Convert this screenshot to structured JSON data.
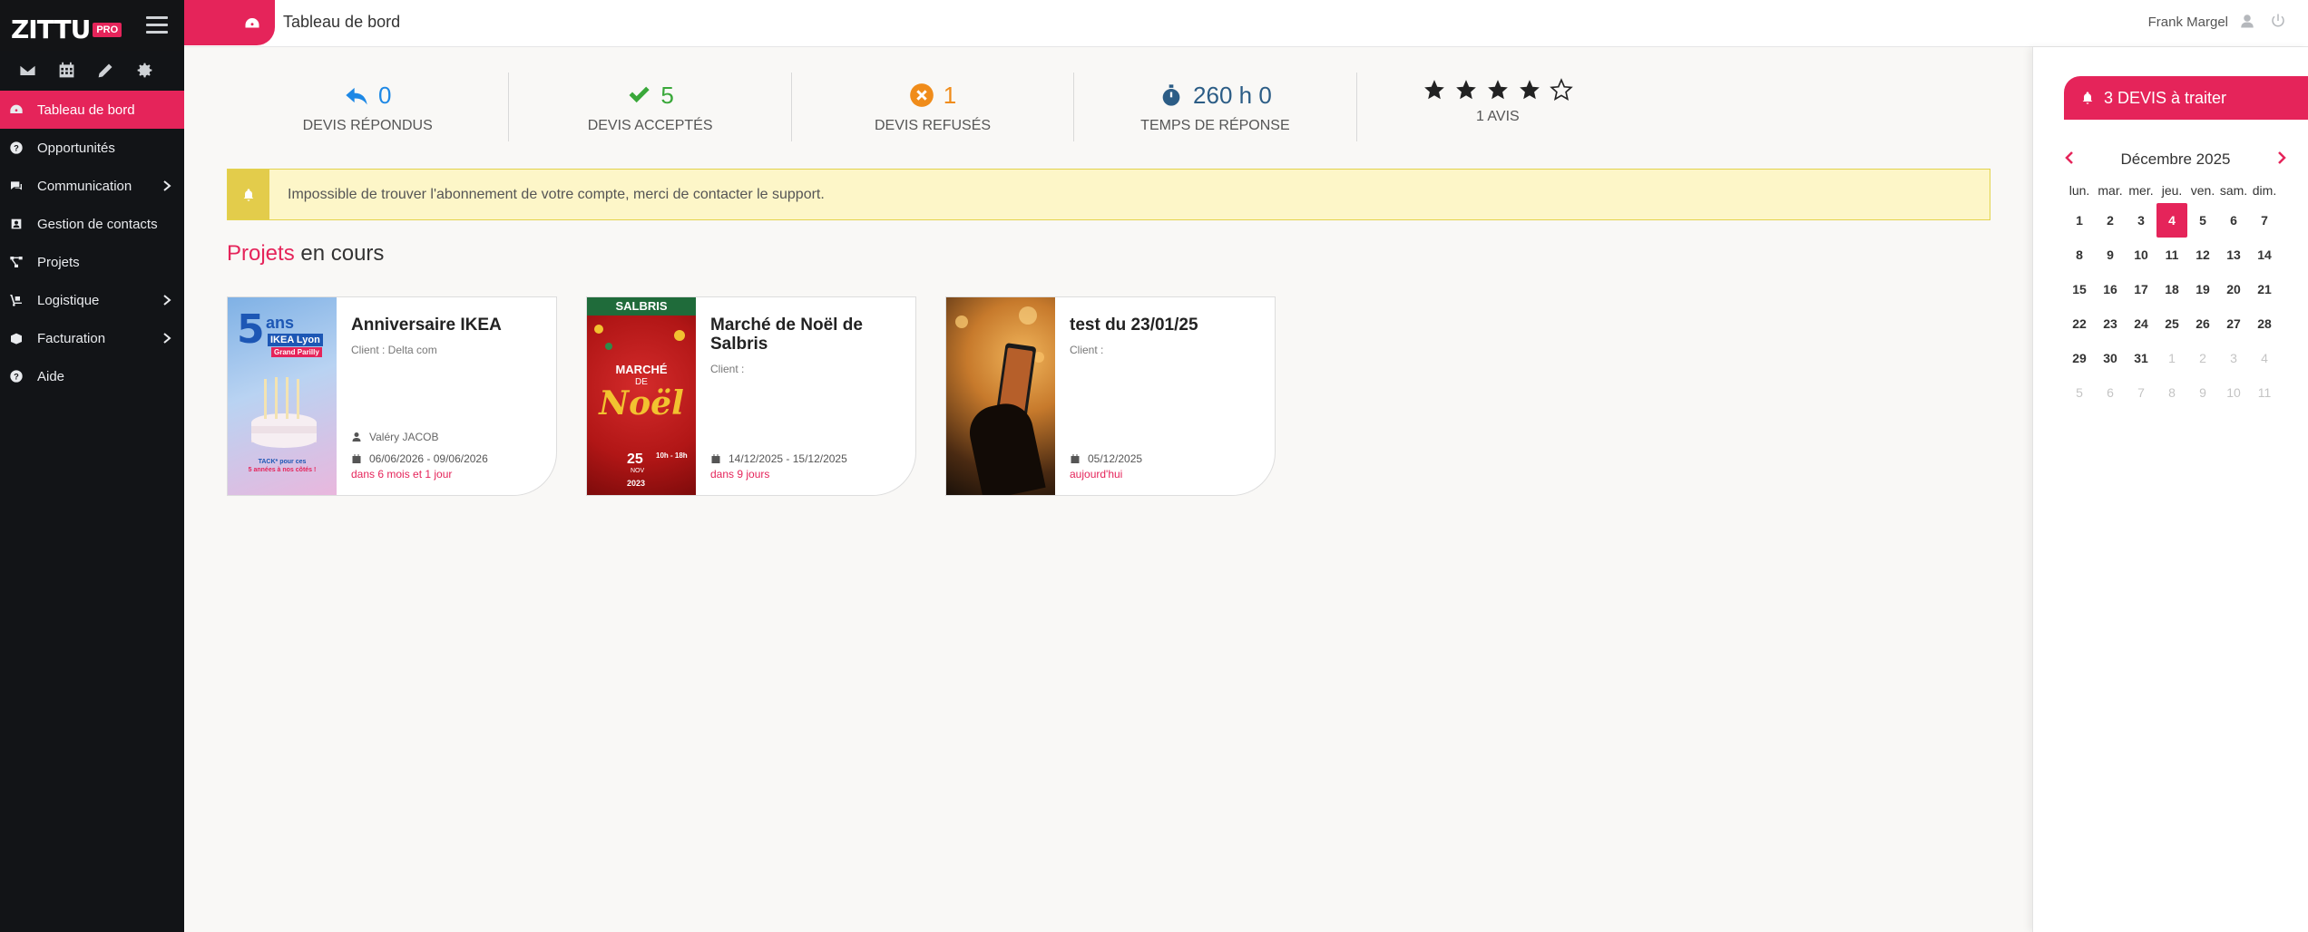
{
  "sidebar": {
    "brand": "ZITTU",
    "brand_badge": "PRO",
    "quick_icons": [
      "envelope-icon",
      "calendar-icon",
      "pencil-icon",
      "gear-icon"
    ],
    "items": [
      {
        "label": "Tableau de bord",
        "icon": "dashboard-icon",
        "active": true
      },
      {
        "label": "Opportunités",
        "icon": "question-circle-icon"
      },
      {
        "label": "Communication",
        "icon": "chat-icon",
        "has_children": true
      },
      {
        "label": "Gestion de contacts",
        "icon": "address-book-icon"
      },
      {
        "label": "Projets",
        "icon": "project-diagram-icon"
      },
      {
        "label": "Logistique",
        "icon": "dolly-icon",
        "has_children": true
      },
      {
        "label": "Facturation",
        "icon": "box-icon",
        "has_children": true
      },
      {
        "label": "Aide",
        "icon": "question-circle-icon"
      }
    ]
  },
  "header": {
    "title": "Tableau de bord",
    "user_name": "Frank Margel"
  },
  "stats": [
    {
      "value": "0",
      "label": "DEVIS RÉPONDUS",
      "color": "#1e88e5",
      "icon": "reply-icon"
    },
    {
      "value": "5",
      "label": "DEVIS ACCEPTÉS",
      "color": "#3aa83a",
      "icon": "check-icon"
    },
    {
      "value": "1",
      "label": "DEVIS REFUSÉS",
      "color": "#f08c1a",
      "icon": "times-circle-icon"
    },
    {
      "value": "260 h 0",
      "label": "TEMPS DE RÉPONSE",
      "color": "#2c5d86",
      "icon": "stopwatch-icon"
    }
  ],
  "rating": {
    "stars_filled": 4,
    "stars_total": 5,
    "label": "1 AVIS"
  },
  "alert": {
    "text": "Impossible de trouver l'abonnement de votre compte, merci de contacter le support."
  },
  "projects_section": {
    "title_accent": "Projets",
    "title_rest": " en cours"
  },
  "projects": [
    {
      "title": "Anniversaire IKEA",
      "client": "Client : Delta com",
      "manager": "Valéry JACOB",
      "dates": "06/06/2026 - 09/06/2026",
      "relative": "dans 6 mois et 1 jour",
      "image": {
        "big": "5",
        "small": "ans",
        "line1": "IKEA Lyon",
        "line2": "Grand Parilly",
        "caption1": "TACK* pour ces",
        "caption2": "5 années à nos côtés !"
      }
    },
    {
      "title": "Marché de Noël de Salbris",
      "client": "Client :",
      "dates": "14/12/2025 - 15/12/2025",
      "relative": "dans 9 jours",
      "image": {
        "top": "SALBRIS",
        "l1": "MARCHÉ",
        "l2": "DE",
        "l3": "Noël",
        "day": "25",
        "month": "NOV",
        "year": "2023",
        "time": "10h - 18h"
      }
    },
    {
      "title": "test du 23/01/25",
      "client": "Client :",
      "dates": "05/12/2025",
      "relative": "aujourd'hui"
    }
  ],
  "right_panel": {
    "devis_button": "3 DEVIS à traiter",
    "calendar": {
      "month": "Décembre 2025",
      "weekdays": [
        "lun.",
        "mar.",
        "mer.",
        "jeu.",
        "ven.",
        "sam.",
        "dim."
      ],
      "today": 4,
      "weeks": [
        [
          "1",
          "2",
          "3",
          "4",
          "5",
          "6",
          "7"
        ],
        [
          "8",
          "9",
          "10",
          "11",
          "12",
          "13",
          "14"
        ],
        [
          "15",
          "16",
          "17",
          "18",
          "19",
          "20",
          "21"
        ],
        [
          "22",
          "23",
          "24",
          "25",
          "26",
          "27",
          "28"
        ],
        [
          "29",
          "30",
          "31",
          "1",
          "2",
          "3",
          "4"
        ],
        [
          "5",
          "6",
          "7",
          "8",
          "9",
          "10",
          "11"
        ]
      ],
      "muted_from_week": 4,
      "muted_from_index": 3
    }
  }
}
